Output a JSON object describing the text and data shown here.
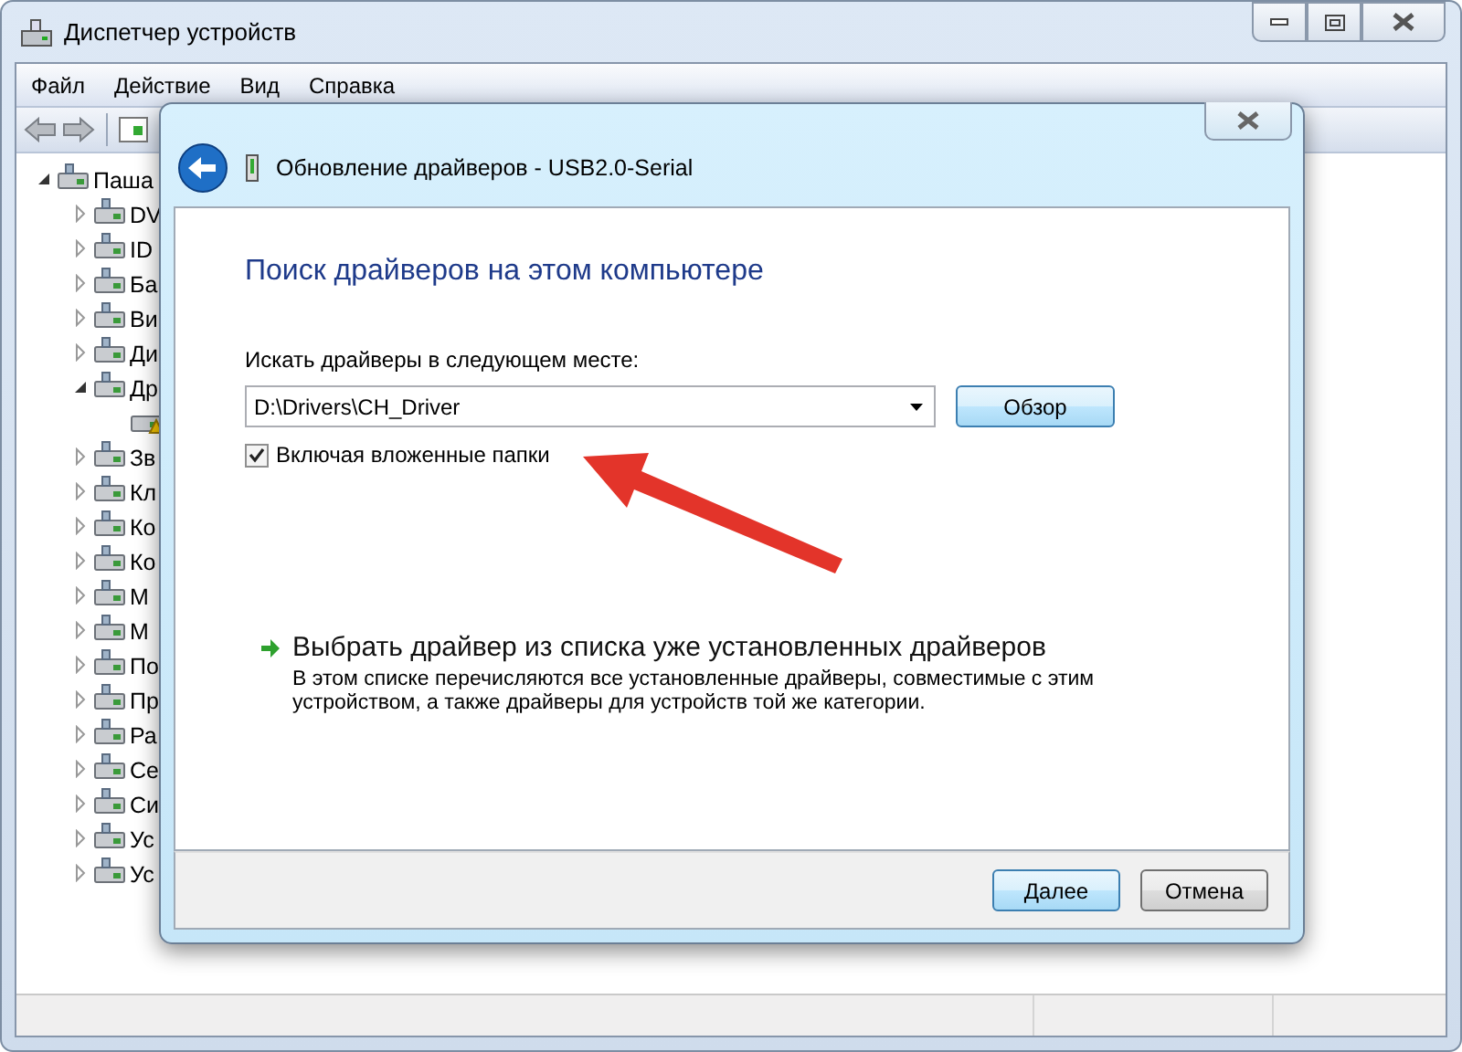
{
  "window": {
    "title": "Диспетчер устройств"
  },
  "menu": [
    {
      "label": "Файл"
    },
    {
      "label": "Действие"
    },
    {
      "label": "Вид"
    },
    {
      "label": "Справка"
    }
  ],
  "tree": {
    "label": "Паша",
    "expanded": true,
    "children": [
      {
        "label": "DV",
        "expanded": false
      },
      {
        "label": "ID",
        "expanded": false
      },
      {
        "label": "Ба",
        "expanded": false
      },
      {
        "label": "Ви",
        "expanded": false
      },
      {
        "label": "Ди",
        "expanded": false
      },
      {
        "label": "Др",
        "expanded": true,
        "children": [
          {
            "warning": true
          }
        ]
      },
      {
        "label": "Зв",
        "expanded": false
      },
      {
        "label": "Кл",
        "expanded": false
      },
      {
        "label": "Ко",
        "expanded": false
      },
      {
        "label": "Ко",
        "expanded": false
      },
      {
        "label": "М",
        "expanded": false
      },
      {
        "label": "М",
        "expanded": false
      },
      {
        "label": "По",
        "expanded": false
      },
      {
        "label": "Пр",
        "expanded": false
      },
      {
        "label": "Ра",
        "expanded": false
      },
      {
        "label": "Се",
        "expanded": false
      },
      {
        "label": "Си",
        "expanded": false
      },
      {
        "label": "Ус",
        "expanded": false
      },
      {
        "label": "Ус",
        "expanded": false
      }
    ]
  },
  "dialog": {
    "title": "Обновление драйверов - USB2.0-Serial",
    "heading": "Поиск драйверов на этом компьютере",
    "path_label": "Искать драйверы в следующем месте:",
    "path_value": "D:\\Drivers\\CH_Driver",
    "browse_button": "Обзор",
    "include_subfolders": {
      "label": "Включая вложенные папки",
      "checked": true
    },
    "pick_link": {
      "title": "Выбрать драйвер из списка уже установленных драйверов",
      "description": "В этом списке перечисляются все установленные драйверы, совместимые с этим устройством, а также драйверы для устройств той же категории."
    },
    "buttons": [
      {
        "label": "Далее",
        "default": true
      },
      {
        "label": "Отмена",
        "default": false
      }
    ]
  }
}
